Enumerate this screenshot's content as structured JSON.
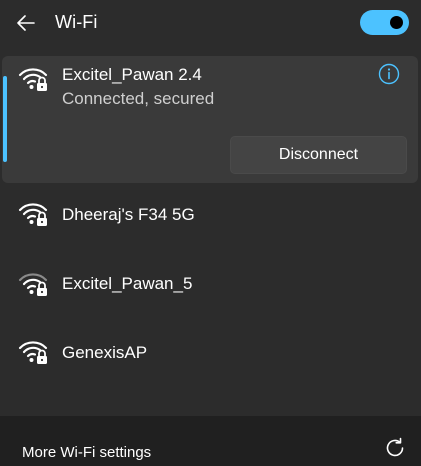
{
  "header": {
    "back_icon": "arrow-left-icon",
    "title": "Wi-Fi",
    "toggle_on": true,
    "accent_color": "#4cc2ff"
  },
  "connected_network": {
    "name": "Excitel_Pawan 2.4",
    "status": "Connected, secured",
    "icon": "wifi-secured-icon",
    "info_icon": "info-icon",
    "disconnect_label": "Disconnect"
  },
  "networks": [
    {
      "name": "Dheeraj's F34 5G",
      "icon": "wifi-secured-icon",
      "signal_bars": 4
    },
    {
      "name": "Excitel_Pawan_5",
      "icon": "wifi-secured-icon",
      "signal_bars": 3
    },
    {
      "name": "GenexisAP",
      "icon": "wifi-secured-icon",
      "signal_bars": 4
    }
  ],
  "footer": {
    "settings_link": "More Wi-Fi settings",
    "refresh_icon": "refresh-icon"
  },
  "colors": {
    "panel_bg": "#2c2c2c",
    "selected_bg": "#3a3a3a",
    "footer_bg": "#202020",
    "accent": "#4cc2ff"
  }
}
